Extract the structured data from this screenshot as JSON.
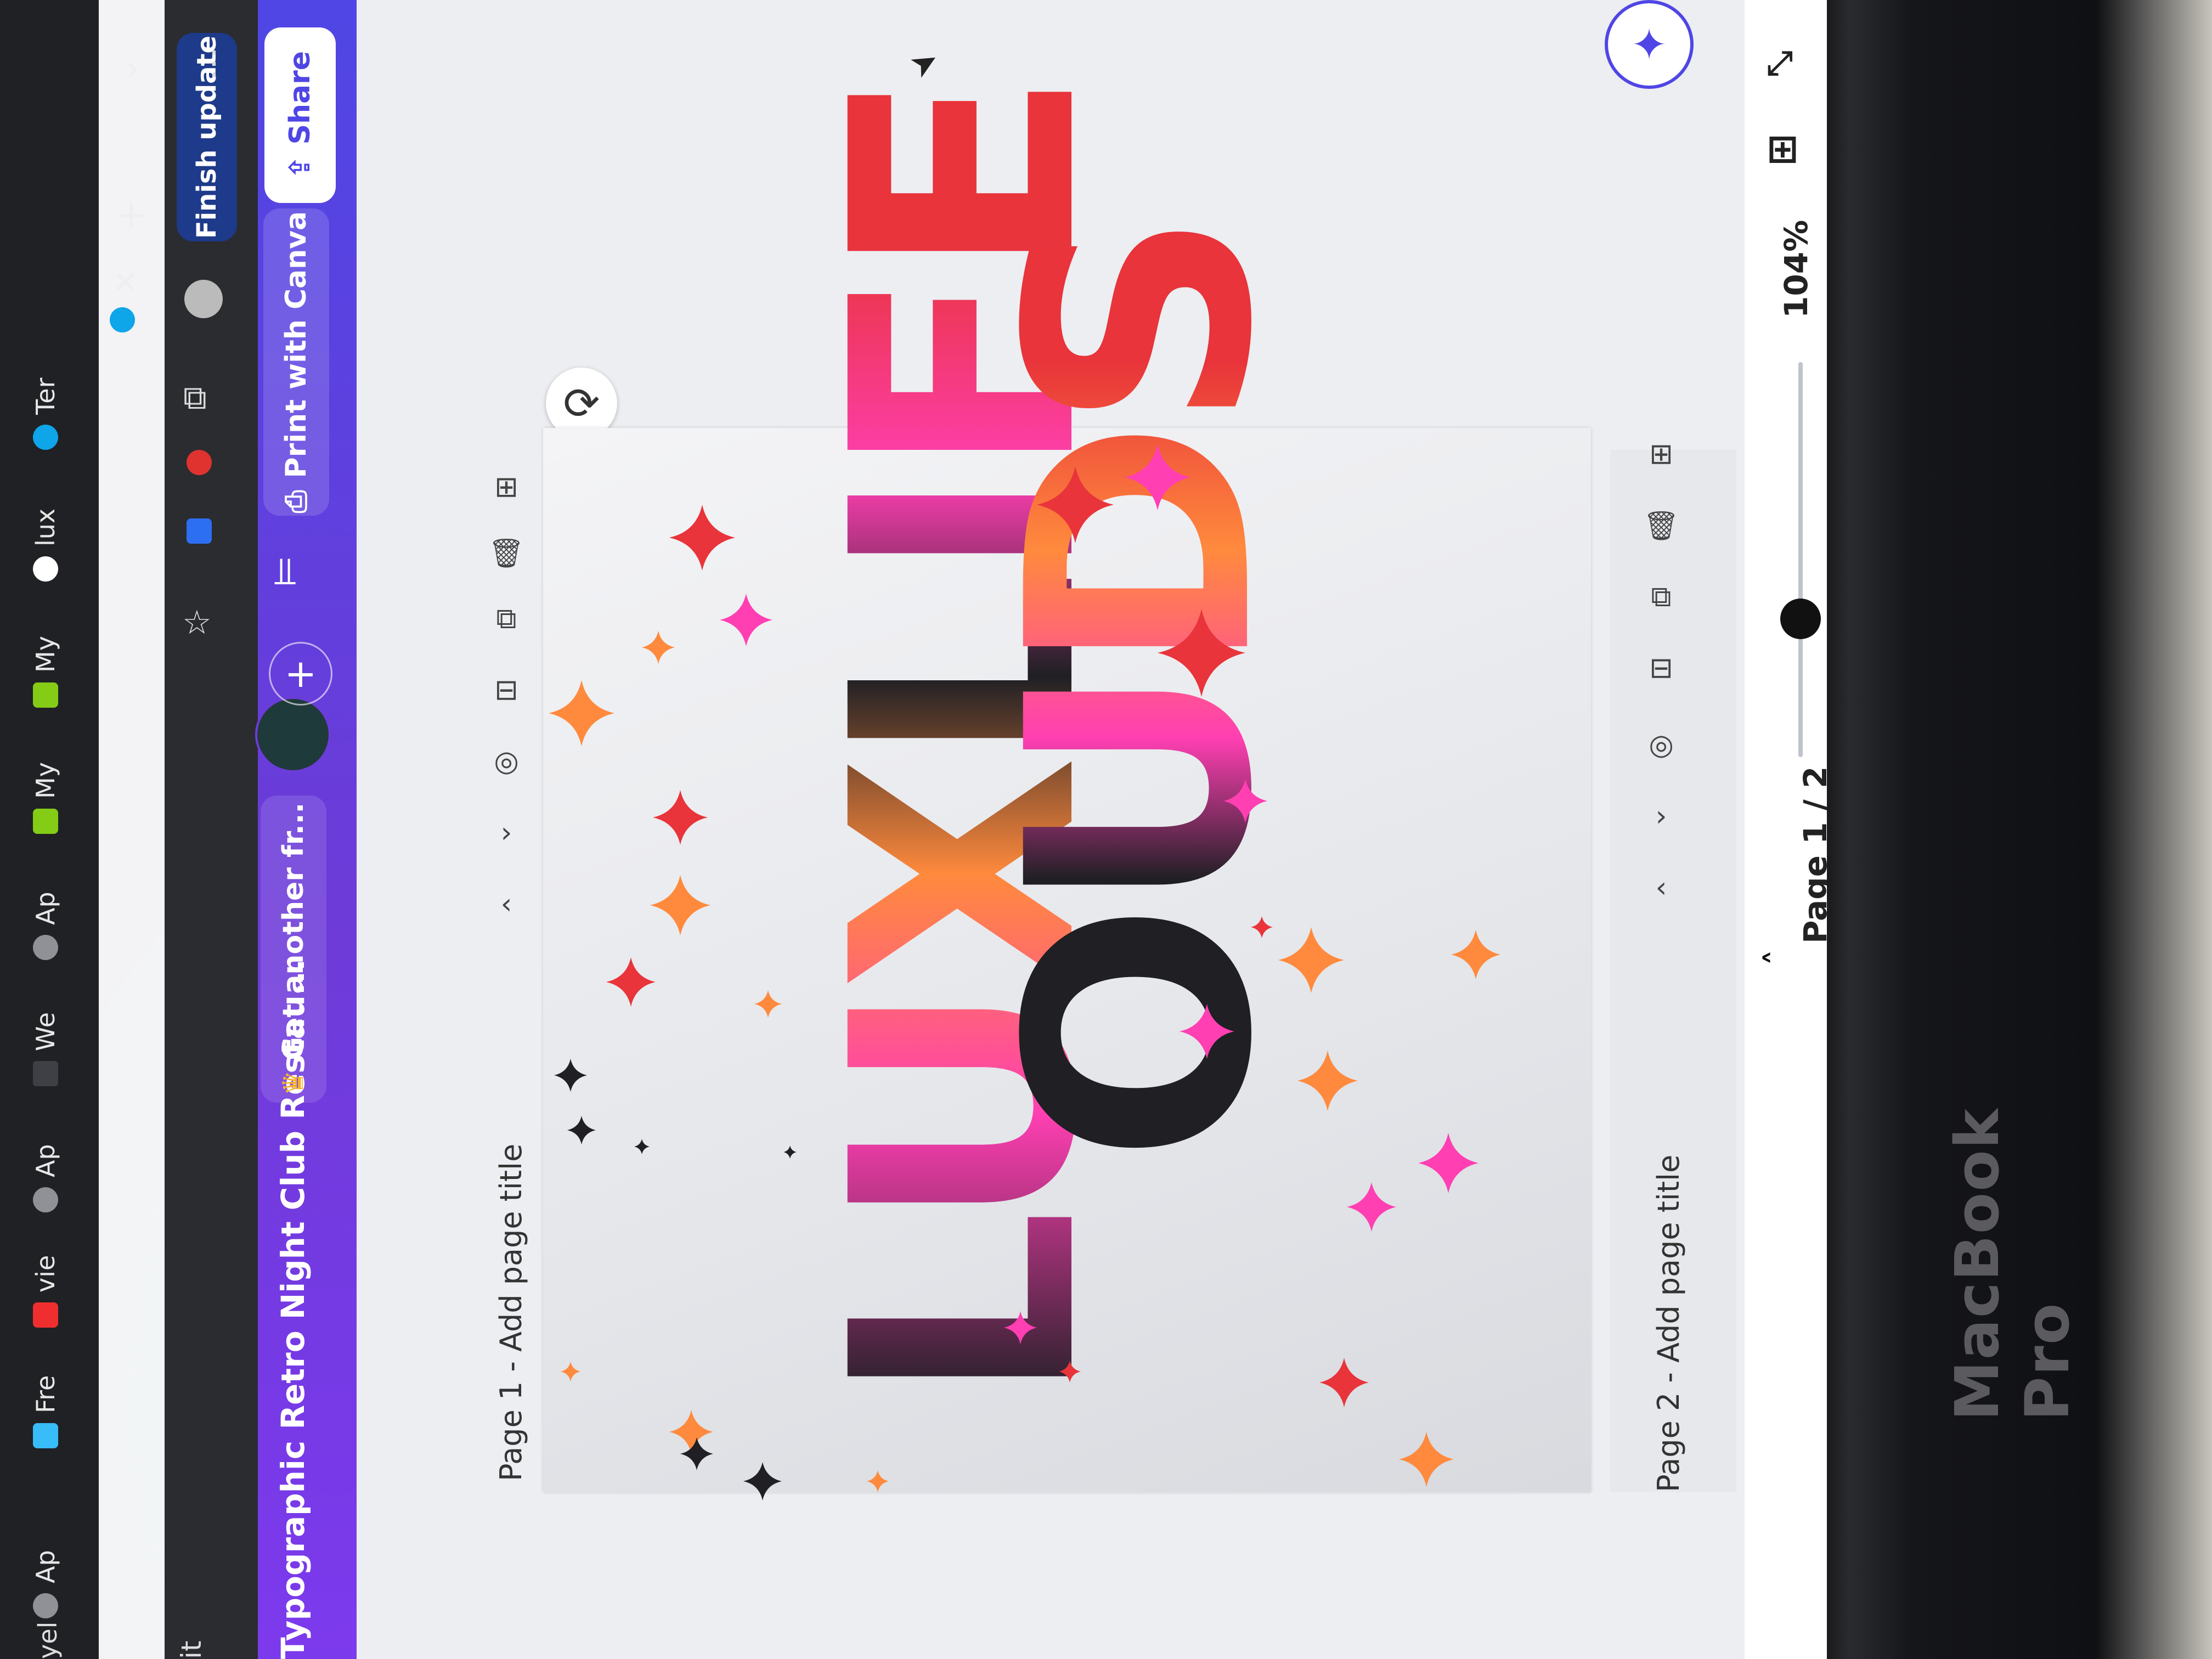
{
  "browser": {
    "tabs": [
      {
        "label": "Fre"
      },
      {
        "label": "vie"
      },
      {
        "label": "Ap"
      },
      {
        "label": "We"
      },
      {
        "label": "Ap"
      },
      {
        "label": "My"
      },
      {
        "label": "My"
      },
      {
        "label": "lux"
      },
      {
        "label": "Ter"
      }
    ],
    "first_tab_label": "Ap",
    "left_edge_text": "yel",
    "address_left_text": "it",
    "finish_update_label": "Finish update",
    "close_tab_glyph": "×",
    "new_tab_glyph": "+",
    "overflow_glyph": "›",
    "menu_glyph": "⋮"
  },
  "canva_header": {
    "doc_title": "Typographic Retro Night Club Restau...",
    "get_another_label": "Get another fr...",
    "print_label": "Print with Canva",
    "share_label": "Share",
    "add_glyph": "+"
  },
  "editor": {
    "page1_title": "Page 1 - Add page title",
    "page2_title": "Page 2 - Add page title",
    "poster_line1": "LUXLIFE",
    "poster_line2": "OUDS",
    "page_indicator": "Page 1 / 2",
    "zoom_level": "104%",
    "zoom_fraction": 0.35
  },
  "device": {
    "brand_label": "MacBook Pro"
  },
  "colors": {
    "canva_purple": "#4f46e5",
    "poster_dark": "#1f1f24",
    "poster_pink": "#ff3fb2",
    "poster_orange": "#ff8a3d",
    "poster_red": "#e8343a"
  }
}
